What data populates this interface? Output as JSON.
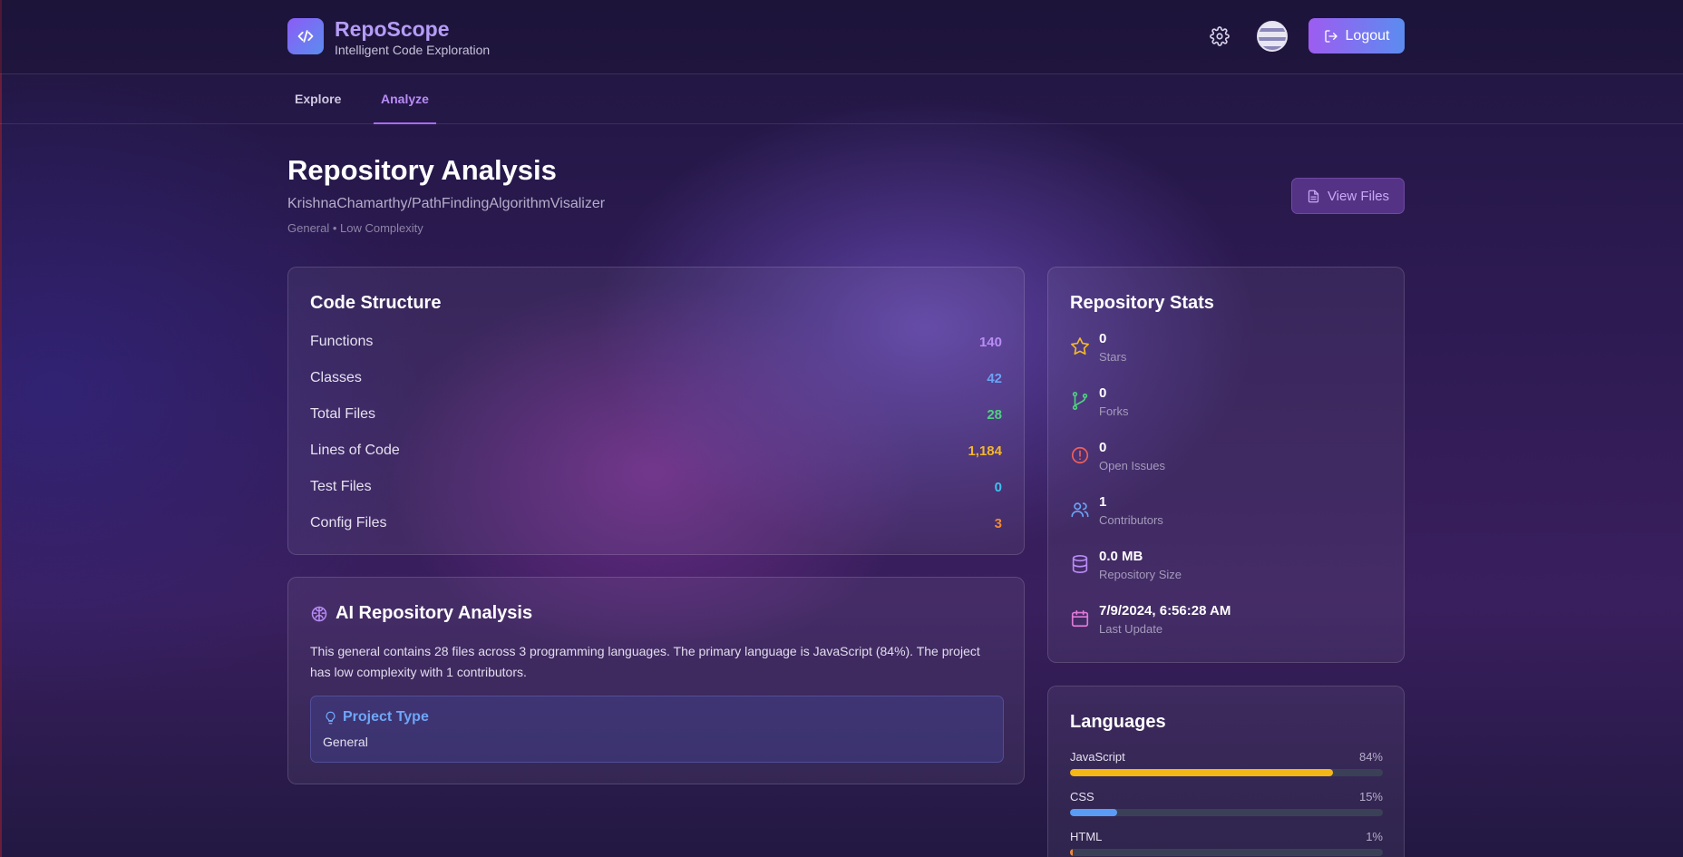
{
  "app": {
    "title": "RepoScope",
    "subtitle": "Intelligent Code Exploration"
  },
  "header": {
    "logout_label": "Logout"
  },
  "tabs": [
    {
      "label": "Explore",
      "active": false
    },
    {
      "label": "Analyze",
      "active": true
    }
  ],
  "page": {
    "title": "Repository Analysis",
    "repo": "KrishnaChamarthy/PathFindingAlgorithmVisalizer",
    "meta": "General • Low Complexity",
    "view_files_label": "View Files"
  },
  "code_structure": {
    "title": "Code Structure",
    "rows": [
      {
        "label": "Functions",
        "value": "140",
        "color": "#b98cf6"
      },
      {
        "label": "Classes",
        "value": "42",
        "color": "#6aa3f5"
      },
      {
        "label": "Total Files",
        "value": "28",
        "color": "#4ed17f"
      },
      {
        "label": "Lines of Code",
        "value": "1,184",
        "color": "#f3b72a"
      },
      {
        "label": "Test Files",
        "value": "0",
        "color": "#3cc2f0"
      },
      {
        "label": "Config Files",
        "value": "3",
        "color": "#f28a35"
      }
    ]
  },
  "ai_analysis": {
    "title": "AI Repository Analysis",
    "description": "This general contains 28 files across 3 programming languages. The primary language is JavaScript (84%). The project has low complexity with 1 contributors.",
    "project_type_label": "Project Type",
    "project_type_value": "General"
  },
  "repo_stats": {
    "title": "Repository Stats",
    "items": [
      {
        "icon": "star-icon",
        "value": "0",
        "label": "Stars",
        "color": "#f3b72a"
      },
      {
        "icon": "fork-icon",
        "value": "0",
        "label": "Forks",
        "color": "#4ed17f"
      },
      {
        "icon": "alert-circle-icon",
        "value": "0",
        "label": "Open Issues",
        "color": "#f0605a"
      },
      {
        "icon": "users-icon",
        "value": "1",
        "label": "Contributors",
        "color": "#6aa3f5"
      },
      {
        "icon": "database-icon",
        "value": "0.0 MB",
        "label": "Repository Size",
        "color": "#b98cf6"
      },
      {
        "icon": "calendar-icon",
        "value": "7/9/2024, 6:56:28 AM",
        "label": "Last Update",
        "color": "#e07ad8"
      }
    ]
  },
  "languages": {
    "title": "Languages",
    "items": [
      {
        "name": "JavaScript",
        "percent_label": "84%",
        "percent": 84,
        "color": "#f3b716"
      },
      {
        "name": "CSS",
        "percent_label": "15%",
        "percent": 15,
        "color": "#5a9cf5"
      },
      {
        "name": "HTML",
        "percent_label": "1%",
        "percent": 1,
        "color": "#f28a35"
      }
    ]
  }
}
